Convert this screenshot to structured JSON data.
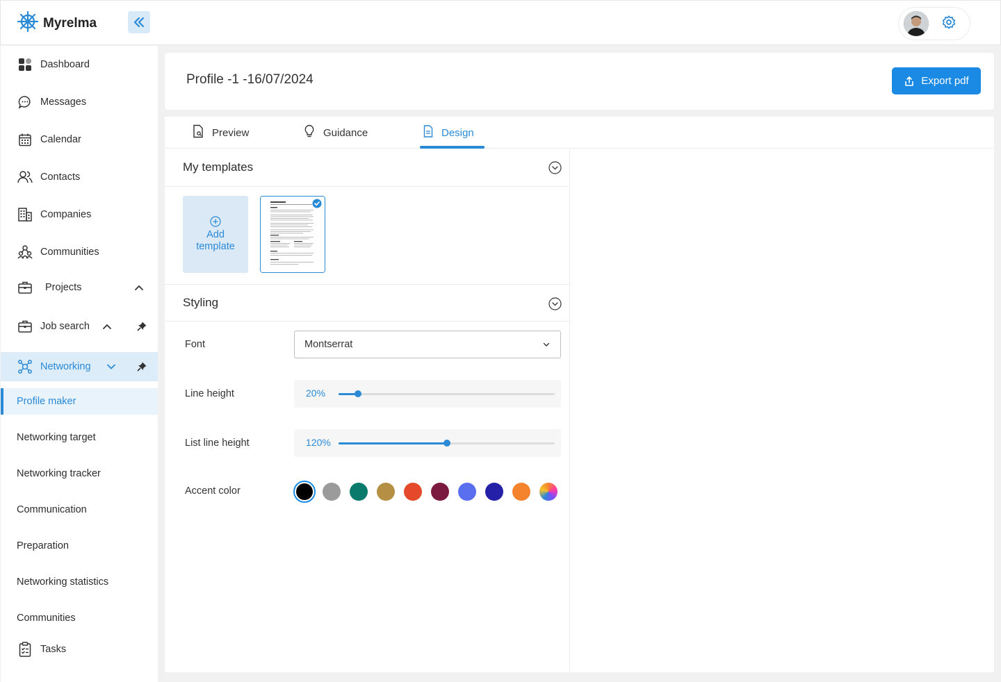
{
  "app": {
    "name": "Myrelma"
  },
  "sidebar": {
    "items": [
      {
        "label": "Dashboard",
        "icon": "dashboard-icon"
      },
      {
        "label": "Messages",
        "icon": "chat-bubble-icon"
      },
      {
        "label": "Calendar",
        "icon": "calendar-icon"
      },
      {
        "label": "Contacts",
        "icon": "contacts-icon"
      },
      {
        "label": "Companies",
        "icon": "building-icon"
      },
      {
        "label": "Communities",
        "icon": "community-icon"
      },
      {
        "label": "Projects",
        "icon": "briefcase-icon"
      },
      {
        "label": "Job search",
        "icon": "briefcase-icon"
      },
      {
        "label": "Networking",
        "icon": "network-icon"
      }
    ],
    "networking_sub": [
      "Profile maker",
      "Networking target",
      "Networking tracker",
      "Communication",
      "Preparation",
      "Networking statistics",
      "Communities"
    ],
    "tasks": {
      "label": "Tasks",
      "icon": "clipboard-check-icon"
    }
  },
  "header": {
    "title": "Profile -1 -16/07/2024",
    "export_label": "Export pdf"
  },
  "tabs": [
    {
      "label": "Preview",
      "icon": "file-preview-icon"
    },
    {
      "label": "Guidance",
      "icon": "lightbulb-icon"
    },
    {
      "label": "Design",
      "icon": "document-icon",
      "active": true
    }
  ],
  "templates": {
    "title": "My templates",
    "add_label_1": "Add",
    "add_label_2": "template"
  },
  "styling": {
    "title": "Styling",
    "font_label": "Font",
    "font_value": "Montserrat",
    "line_height_label": "Line height",
    "line_height_value": "20%",
    "line_height_fraction": 0.09,
    "list_line_height_label": "List line height",
    "list_line_height_value": "120%",
    "list_line_height_fraction": 0.5,
    "accent_label": "Accent color",
    "accent_colors": [
      "#000000",
      "#9b9b9b",
      "#0a7a6c",
      "#b58f43",
      "#e3492a",
      "#7a1a3e",
      "#5a6ff0",
      "#2421a8",
      "#f5822d",
      "gradient"
    ],
    "accent_selected": "#000000"
  },
  "colors": {
    "accent": "#2a8ad6",
    "primary_button": "#1a8ae4"
  }
}
